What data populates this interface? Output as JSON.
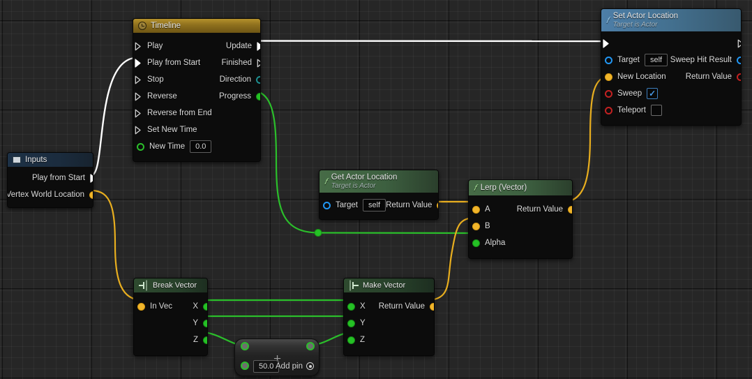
{
  "graph": {
    "app": "Blueprint Graph Editor",
    "background_color": "#262626",
    "grid_color": "#333333"
  },
  "nodes": {
    "inputs": {
      "title": "Inputs",
      "icon": "input-node-icon",
      "header_color": "#1d3146",
      "outputs": [
        {
          "label": "Play from Start",
          "pin": "exec-pin",
          "color": "#ffffff"
        },
        {
          "label": "Vertex World Location",
          "pin": "vector-pin",
          "color": "#f0b52b"
        }
      ]
    },
    "timeline": {
      "title": "Timeline",
      "icon": "clock-icon",
      "header_color": "#8d6f1d",
      "inputs": [
        {
          "label": "Play",
          "pin": "exec-pin"
        },
        {
          "label": "Play from Start",
          "pin": "exec-pin",
          "connected": true
        },
        {
          "label": "Stop",
          "pin": "exec-pin"
        },
        {
          "label": "Reverse",
          "pin": "exec-pin"
        },
        {
          "label": "Reverse from End",
          "pin": "exec-pin"
        },
        {
          "label": "Set New Time",
          "pin": "exec-pin"
        },
        {
          "label": "New Time",
          "pin": "float-pin",
          "value": "0.0"
        }
      ],
      "outputs": [
        {
          "label": "Update",
          "pin": "exec-pin",
          "connected": true
        },
        {
          "label": "Finished",
          "pin": "exec-pin"
        },
        {
          "label": "Direction",
          "pin": "enum-pin"
        },
        {
          "label": "Progress",
          "pin": "float-pin",
          "connected": true
        }
      ]
    },
    "set_actor_location": {
      "title": "Set Actor Location",
      "subtitle": "Target is Actor",
      "icon": "function-icon",
      "header_color": "#43708f",
      "inputs": [
        {
          "label": "Target",
          "pin": "object-pin",
          "value": "self"
        },
        {
          "label": "New Location",
          "pin": "vector-pin",
          "connected": true
        },
        {
          "label": "Sweep",
          "pin": "bool-pin",
          "checked": true
        },
        {
          "label": "Teleport",
          "pin": "bool-pin",
          "checked": false
        }
      ],
      "outputs": [
        {
          "label": "Sweep Hit Result",
          "pin": "struct-pin"
        },
        {
          "label": "Return Value",
          "pin": "bool-pin"
        }
      ]
    },
    "get_actor_location": {
      "title": "Get Actor Location",
      "subtitle": "Target is Actor",
      "icon": "function-icon",
      "header_color": "#3d6040",
      "inputs": [
        {
          "label": "Target",
          "pin": "object-pin",
          "value": "self"
        }
      ],
      "outputs": [
        {
          "label": "Return Value",
          "pin": "vector-pin",
          "connected": true
        }
      ]
    },
    "lerp_vector": {
      "title": "Lerp (Vector)",
      "icon": "function-icon",
      "header_color": "#3d6040",
      "inputs": [
        {
          "label": "A",
          "pin": "vector-pin",
          "connected": true
        },
        {
          "label": "B",
          "pin": "vector-pin",
          "connected": true
        },
        {
          "label": "Alpha",
          "pin": "float-pin",
          "connected": true
        }
      ],
      "outputs": [
        {
          "label": "Return Value",
          "pin": "vector-pin",
          "connected": true
        }
      ]
    },
    "break_vector": {
      "title": "Break Vector",
      "icon": "break-struct-icon",
      "header_color": "#27402a",
      "inputs": [
        {
          "label": "In Vec",
          "pin": "vector-pin",
          "connected": true
        }
      ],
      "outputs": [
        {
          "label": "X",
          "pin": "float-pin",
          "connected": true
        },
        {
          "label": "Y",
          "pin": "float-pin",
          "connected": true
        },
        {
          "label": "Z",
          "pin": "float-pin",
          "connected": true
        }
      ]
    },
    "make_vector": {
      "title": "Make Vector",
      "icon": "make-struct-icon",
      "header_color": "#27402a",
      "inputs": [
        {
          "label": "X",
          "pin": "float-pin",
          "connected": true
        },
        {
          "label": "Y",
          "pin": "float-pin",
          "connected": true
        },
        {
          "label": "Z",
          "pin": "float-pin",
          "connected": true
        }
      ],
      "outputs": [
        {
          "label": "Return Value",
          "pin": "vector-pin",
          "connected": true
        }
      ]
    },
    "add": {
      "title": "+",
      "icon": "plus-icon",
      "add_pin_label": "Add pin",
      "add_pin_icon": "add-pin-icon",
      "inputs": [
        {
          "label": "",
          "pin": "float-pin",
          "connected": true
        },
        {
          "label": "",
          "pin": "float-pin",
          "value": "50.0"
        }
      ],
      "outputs": [
        {
          "label": "",
          "pin": "float-pin",
          "connected": true
        }
      ]
    }
  },
  "wire_colors": {
    "exec": "#ffffff",
    "vector": "#e8ae1f",
    "float": "#2bbf2b"
  }
}
